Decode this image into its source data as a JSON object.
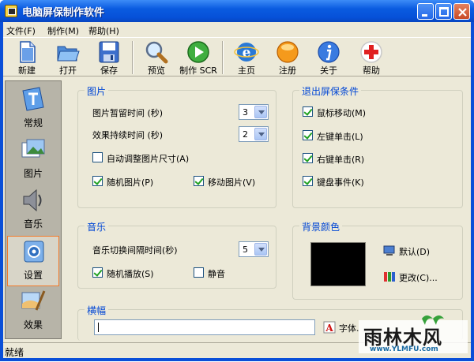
{
  "window": {
    "title": "电脑屏保制作软件"
  },
  "menu": {
    "items": [
      {
        "label": "文件(F)"
      },
      {
        "label": "制作(M)"
      },
      {
        "label": "帮助(H)"
      }
    ]
  },
  "toolbar": {
    "items": [
      {
        "label": "新建",
        "icon": "new-document-icon"
      },
      {
        "label": "打开",
        "icon": "open-folder-icon"
      },
      {
        "label": "保存",
        "icon": "save-disk-icon"
      },
      {
        "label": "预览",
        "icon": "magnifier-icon"
      },
      {
        "label": "制作 SCR",
        "icon": "play-icon"
      },
      {
        "label": "主页",
        "icon": "browser-icon"
      },
      {
        "label": "注册",
        "icon": "register-icon"
      },
      {
        "label": "关于",
        "icon": "info-icon"
      },
      {
        "label": "帮助",
        "icon": "help-icon"
      }
    ]
  },
  "sidebar": {
    "items": [
      {
        "label": "常规",
        "icon": "general-icon"
      },
      {
        "label": "图片",
        "icon": "pictures-icon"
      },
      {
        "label": "音乐",
        "icon": "speaker-icon"
      },
      {
        "label": "设置",
        "icon": "settings-icon",
        "active": true
      },
      {
        "label": "效果",
        "icon": "effects-icon"
      }
    ]
  },
  "pictures": {
    "title": "图片",
    "pause_label": "图片暂留时间 (秒)",
    "pause_value": "3",
    "duration_label": "效果持续时间 (秒)",
    "duration_value": "2",
    "auto_resize": {
      "label": "自动调整图片尺寸(A)",
      "checked": false
    },
    "random": {
      "label": "随机图片(P)",
      "checked": true
    },
    "move": {
      "label": "移动图片(V)",
      "checked": true
    }
  },
  "exit": {
    "title": "退出屏保条件",
    "mouse_move": {
      "label": "鼠标移动(M)",
      "checked": true
    },
    "left_click": {
      "label": "左键单击(L)",
      "checked": true
    },
    "right_click": {
      "label": "右键单击(R)",
      "checked": true
    },
    "keyboard": {
      "label": "键盘事件(K)",
      "checked": true
    }
  },
  "music": {
    "title": "音乐",
    "interval_label": "音乐切换间隔时间(秒)",
    "interval_value": "5",
    "random": {
      "label": "随机播放(S)",
      "checked": true
    },
    "mute": {
      "label": "静音",
      "checked": false
    }
  },
  "background": {
    "title": "背景颜色",
    "color": "#000000",
    "default_label": "默认(D)",
    "change_label": "更改(C)..."
  },
  "banner": {
    "title": "横幅",
    "value": "",
    "font_label": "字体."
  },
  "status": {
    "text": "就绪"
  },
  "watermark": {
    "name": "雨林木风",
    "url": "www.YLMFU.com"
  }
}
